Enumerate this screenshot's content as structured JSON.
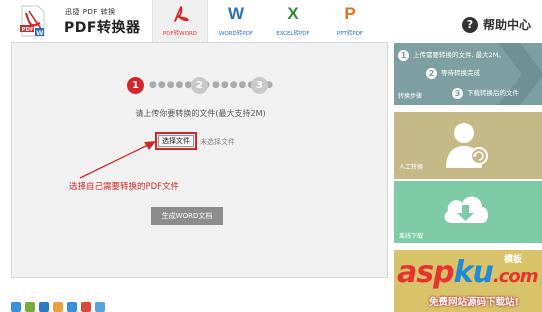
{
  "header": {
    "logo_small": "迅捷 PDF 转换",
    "logo_big": "PDF转换器",
    "tabs": [
      {
        "label": "PDF转WORD",
        "active": true,
        "icon": "acrobat-icon",
        "color": "#d3282b"
      },
      {
        "label": "WORD转PDF",
        "letter": "W",
        "icon": "word-icon",
        "color": "#2a6fba"
      },
      {
        "label": "EXCEL转PDF",
        "letter": "X",
        "icon": "excel-icon",
        "color": "#2e8b3e"
      },
      {
        "label": "PPT转PDF",
        "letter": "P",
        "icon": "ppt-icon",
        "color": "#e0731f"
      }
    ],
    "help_label": "帮助中心"
  },
  "main": {
    "steps": [
      "1",
      "2",
      "3"
    ],
    "hint": "请上传你要转换的文件(最大支持2M)",
    "choose_button": "选择文件",
    "no_file_text": "未选择文件",
    "annotation": "选择自己需要转换的PDF文件",
    "generate_button": "生成WORD文档"
  },
  "sidebar": {
    "convert_steps": {
      "label": "转换步骤",
      "items": [
        {
          "num": "1",
          "text": "上传需要转换的文件, 最大2M。"
        },
        {
          "num": "2",
          "text": "等待转换完成"
        },
        {
          "num": "3",
          "text": "下载转换后的文件"
        }
      ]
    },
    "manual_label": "人工转换",
    "download_label": "离线下载",
    "template_text": "模板"
  },
  "watermark": {
    "main_red_1": "asp",
    "main_blue": "ku",
    "main_red_2": ".com",
    "sub": "免费网站源码下载站!"
  },
  "colors": {
    "accent_red": "#d3282b",
    "steps_card": "#7d9fa1",
    "manual_card": "#c5b987",
    "download_card": "#7fcaa7",
    "template_card": "#d8c26a"
  }
}
